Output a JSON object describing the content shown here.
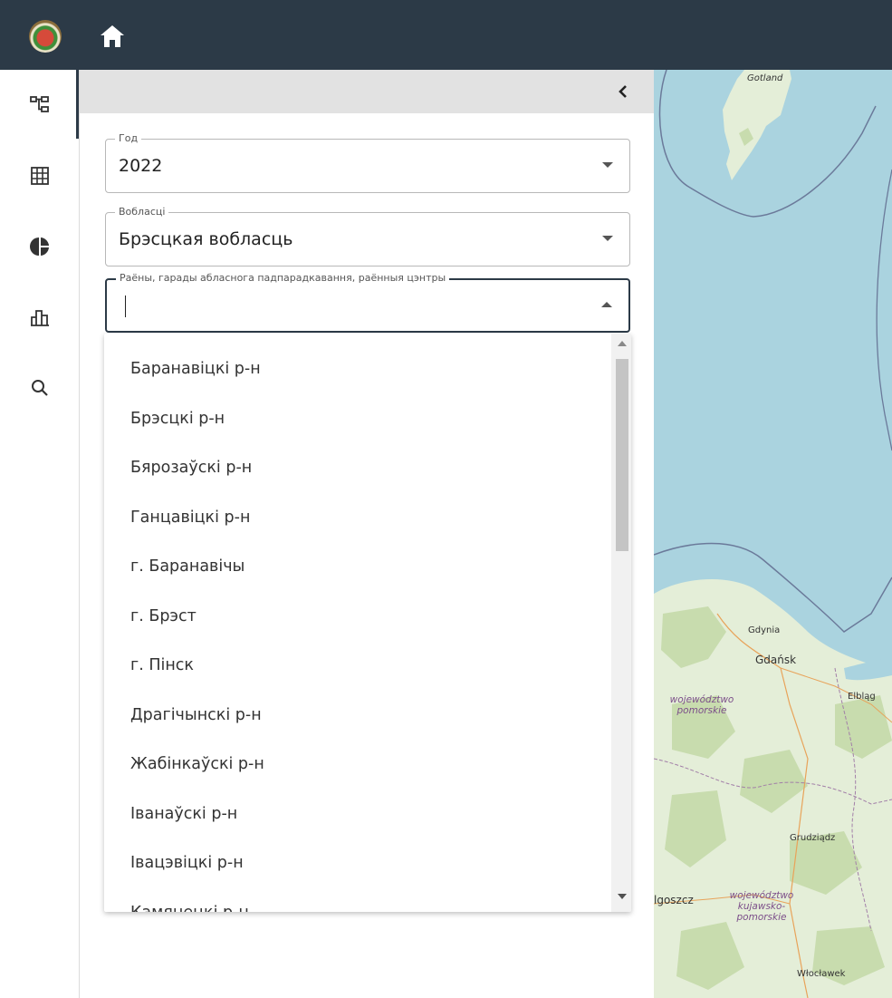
{
  "header": {
    "logo_icon": "coat-of-arms-logo",
    "home_icon": "home-icon"
  },
  "sidebar": {
    "items": [
      {
        "icon": "hierarchy-icon",
        "active": true
      },
      {
        "icon": "table-grid-icon",
        "active": false
      },
      {
        "icon": "pie-chart-icon",
        "active": false
      },
      {
        "icon": "bar-chart-icon",
        "active": false
      },
      {
        "icon": "search-icon",
        "active": false
      }
    ]
  },
  "panel": {
    "collapse_icon": "chevron-left-icon",
    "year_field": {
      "label": "Год",
      "value": "2022"
    },
    "region_field": {
      "label": "Вобласці",
      "value": "Брэсцкая вобласць"
    },
    "district_field": {
      "label": "Раёны, гарады абласнога падпарадкавання, раённыя цэнтры",
      "value": ""
    }
  },
  "dropdown": {
    "options": [
      "Баранавіцкі р-н",
      "Брэсцкі р-н",
      "Бярозаўскі р-н",
      "Ганцавіцкі р-н",
      "г. Баранавічы",
      "г. Брэст",
      "г. Пінск",
      "Драгічынскі р-н",
      "Жабінкаўскі р-н",
      "Іванаўскі р-н",
      "Івацэвіцкі р-н",
      "Камянецкі р-н"
    ]
  },
  "map": {
    "labels": {
      "gotland": "Gotland",
      "gdynia": "Gdynia",
      "gdansk": "Gdańsk",
      "elblag": "Elbląg",
      "pomorskie": "województwo pomorskie",
      "grudziadz": "Grudziądz",
      "bydgoszcz": "lgoszcz",
      "kujawsko": "województwo kujawsko-pomorskie",
      "wloclawek": "Włocławek"
    },
    "colors": {
      "sea": "#aad3df",
      "land": "#e4eed8",
      "forest": "#c8dcae"
    }
  }
}
